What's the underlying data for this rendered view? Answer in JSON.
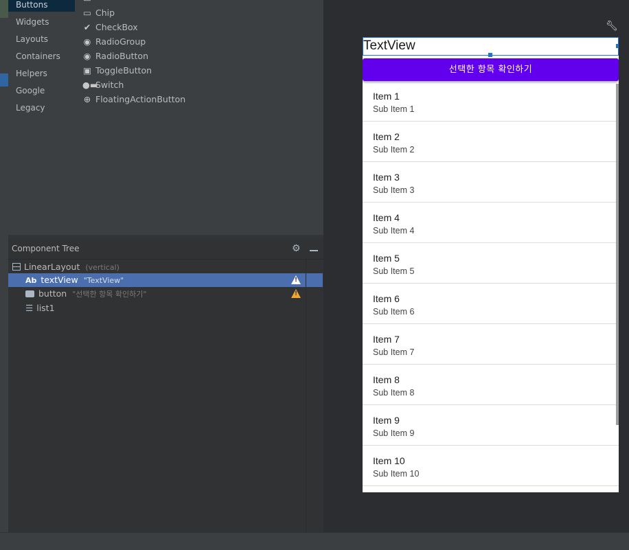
{
  "palette": {
    "categories": [
      "Buttons",
      "Widgets",
      "Layouts",
      "Containers",
      "Helpers",
      "Google",
      "Legacy"
    ],
    "selected_category": "Buttons",
    "items": [
      {
        "label": "Chip",
        "icon": "chip-icon"
      },
      {
        "label": "CheckBox",
        "icon": "checkmark-icon"
      },
      {
        "label": "RadioGroup",
        "icon": "radio-icon"
      },
      {
        "label": "RadioButton",
        "icon": "radio-icon"
      },
      {
        "label": "ToggleButton",
        "icon": "toggle-icon"
      },
      {
        "label": "Switch",
        "icon": "switch-icon"
      },
      {
        "label": "FloatingActionButton",
        "icon": "plus-circle-icon"
      }
    ]
  },
  "tree": {
    "title": "Component Tree",
    "nodes": [
      {
        "label": "LinearLayout",
        "hint": "(vertical)",
        "icon": "linear-layout-icon"
      },
      {
        "label": "textView",
        "hint": "\"TextView\"",
        "icon": "textview-icon",
        "icon_text": "Ab",
        "warning": true,
        "selected": true
      },
      {
        "label": "button",
        "hint": "\"선택한 항목 확인하기\"",
        "icon": "button-icon",
        "warning": true
      },
      {
        "label": "list1",
        "icon": "list-icon"
      }
    ]
  },
  "preview": {
    "textview": "TextView",
    "button": "선택한 항목 확인하기",
    "button_color": "#6200ee",
    "items": [
      {
        "title": "Item 1",
        "sub": "Sub Item 1"
      },
      {
        "title": "Item 2",
        "sub": "Sub Item 2"
      },
      {
        "title": "Item 3",
        "sub": "Sub Item 3"
      },
      {
        "title": "Item 4",
        "sub": "Sub Item 4"
      },
      {
        "title": "Item 5",
        "sub": "Sub Item 5"
      },
      {
        "title": "Item 6",
        "sub": "Sub Item 6"
      },
      {
        "title": "Item 7",
        "sub": "Sub Item 7"
      },
      {
        "title": "Item 8",
        "sub": "Sub Item 8"
      },
      {
        "title": "Item 9",
        "sub": "Sub Item 9"
      },
      {
        "title": "Item 10",
        "sub": "Sub Item 10"
      }
    ]
  },
  "colors": {
    "selection": "#4b6eaf",
    "warning": "#f0a732",
    "selection_border": "#1f74cf"
  }
}
